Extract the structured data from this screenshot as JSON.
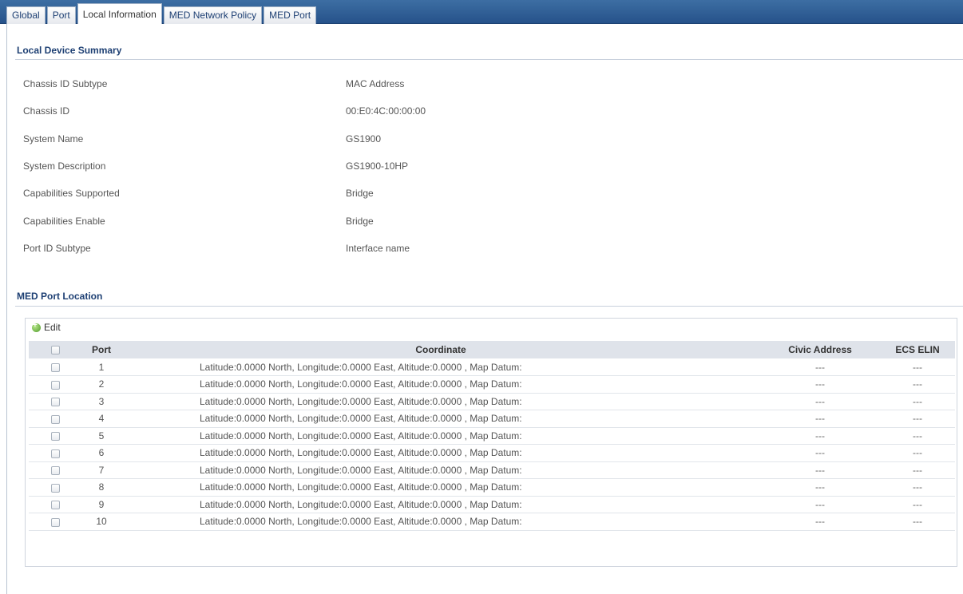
{
  "tabs": [
    {
      "label": "Global",
      "active": false
    },
    {
      "label": "Port",
      "active": false
    },
    {
      "label": "Local Information",
      "active": true
    },
    {
      "label": "MED Network Policy",
      "active": false
    },
    {
      "label": "MED Port",
      "active": false
    }
  ],
  "local_summary": {
    "title": "Local Device Summary",
    "rows": [
      {
        "label": "Chassis ID Subtype",
        "value": "MAC Address"
      },
      {
        "label": "Chassis ID",
        "value": "00:E0:4C:00:00:00"
      },
      {
        "label": "System Name",
        "value": "GS1900"
      },
      {
        "label": "System Description",
        "value": "GS1900-10HP"
      },
      {
        "label": "Capabilities Supported",
        "value": "Bridge"
      },
      {
        "label": "Capabilities Enable",
        "value": "Bridge"
      },
      {
        "label": "Port ID Subtype",
        "value": "Interface name"
      }
    ]
  },
  "med_port_location": {
    "title": "MED Port Location",
    "edit_label": "Edit",
    "columns": [
      "Port",
      "Coordinate",
      "Civic Address",
      "ECS ELIN"
    ],
    "rows": [
      {
        "port": "1",
        "coordinate": "Latitude:0.0000 North, Longitude:0.0000 East, Altitude:0.0000 , Map Datum:",
        "civic": "---",
        "ecs": "---"
      },
      {
        "port": "2",
        "coordinate": "Latitude:0.0000 North, Longitude:0.0000 East, Altitude:0.0000 , Map Datum:",
        "civic": "---",
        "ecs": "---"
      },
      {
        "port": "3",
        "coordinate": "Latitude:0.0000 North, Longitude:0.0000 East, Altitude:0.0000 , Map Datum:",
        "civic": "---",
        "ecs": "---"
      },
      {
        "port": "4",
        "coordinate": "Latitude:0.0000 North, Longitude:0.0000 East, Altitude:0.0000 , Map Datum:",
        "civic": "---",
        "ecs": "---"
      },
      {
        "port": "5",
        "coordinate": "Latitude:0.0000 North, Longitude:0.0000 East, Altitude:0.0000 , Map Datum:",
        "civic": "---",
        "ecs": "---"
      },
      {
        "port": "6",
        "coordinate": "Latitude:0.0000 North, Longitude:0.0000 East, Altitude:0.0000 , Map Datum:",
        "civic": "---",
        "ecs": "---"
      },
      {
        "port": "7",
        "coordinate": "Latitude:0.0000 North, Longitude:0.0000 East, Altitude:0.0000 , Map Datum:",
        "civic": "---",
        "ecs": "---"
      },
      {
        "port": "8",
        "coordinate": "Latitude:0.0000 North, Longitude:0.0000 East, Altitude:0.0000 , Map Datum:",
        "civic": "---",
        "ecs": "---"
      },
      {
        "port": "9",
        "coordinate": "Latitude:0.0000 North, Longitude:0.0000 East, Altitude:0.0000 , Map Datum:",
        "civic": "---",
        "ecs": "---"
      },
      {
        "port": "10",
        "coordinate": "Latitude:0.0000 North, Longitude:0.0000 East, Altitude:0.0000 , Map Datum:",
        "civic": "---",
        "ecs": "---"
      }
    ]
  }
}
